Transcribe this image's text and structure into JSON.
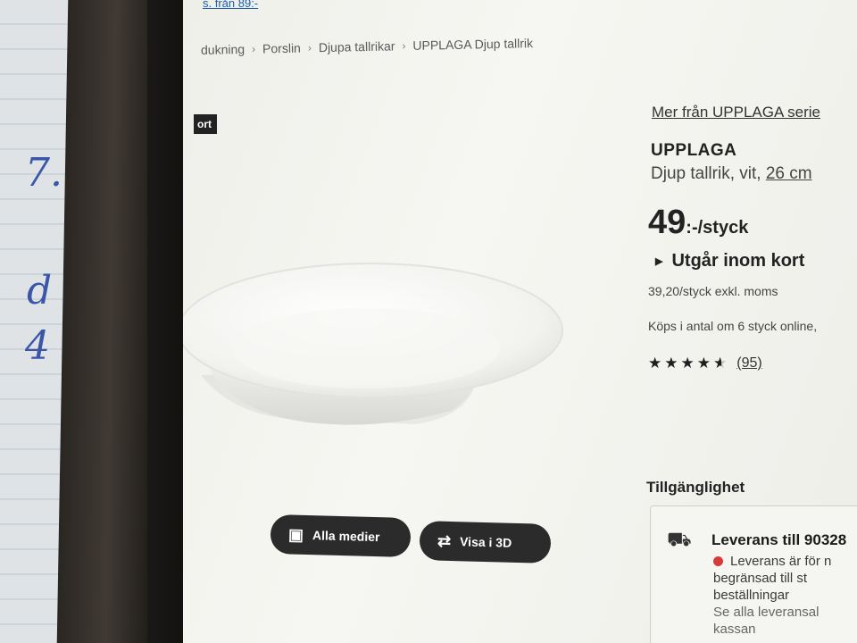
{
  "top_link": "s. från 89:-",
  "breadcrumb": [
    "dukning",
    "Porslin",
    "Djupa tallrikar",
    "UPPLAGA Djup tallrik"
  ],
  "badge": "ort",
  "media_buttons": {
    "all_media": "Alla medier",
    "view_3d": "Visa i 3D"
  },
  "product": {
    "more_from_series": "Mer från UPPLAGA serie",
    "name": "UPPLAGA",
    "description": "Djup tallrik, vit,",
    "size": "26 cm",
    "price_main": "49",
    "price_unit": ":-/styck",
    "status": "Utgår inom kort",
    "price_ex_vat": "39,20/styck exkl. moms",
    "quantity_note": "Köps i antal om 6 styck online,",
    "rating": 4.5,
    "review_count": "(95)"
  },
  "availability": {
    "heading": "Tillgänglighet",
    "delivery_title": "Leverans till 90328",
    "delivery_lines": [
      "Leverans är för n",
      "begränsad till st",
      "beställningar",
      "Se alla leveransal",
      "kassan"
    ]
  },
  "notebook_marks": [
    "7.",
    "d",
    "4"
  ],
  "colors": {
    "button_bg": "#2b2b2b",
    "status_red": "#d63b3b",
    "link": "#333333"
  },
  "icons": {
    "all_media": "media-gallery-icon",
    "view_3d": "rotate-3d-icon",
    "delivery": "truck-icon",
    "status": "triangle-right-icon"
  }
}
